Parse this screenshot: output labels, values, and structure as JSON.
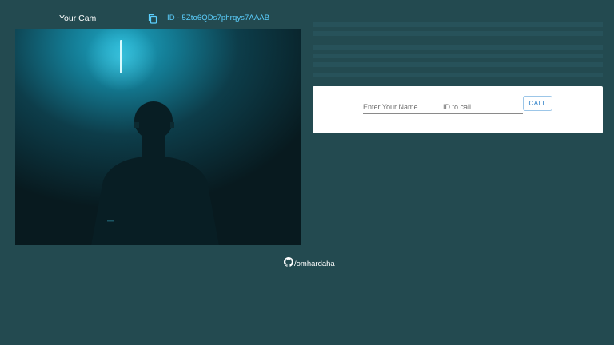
{
  "camera": {
    "title": "Your Cam",
    "id_text": "ID - 5Zto6QDs7phrqys7AAAB",
    "copy_icon": "copy-icon"
  },
  "call_form": {
    "name_placeholder": "Enter Your Name",
    "id_placeholder": "ID to call",
    "call_label": "CALL"
  },
  "footer": {
    "github_icon": "github-icon",
    "link_text": "/omhardaha"
  },
  "colors": {
    "background": "#234a50",
    "accent": "#5cd0ff",
    "card": "#ffffff",
    "button_text": "#2b7fc8"
  }
}
